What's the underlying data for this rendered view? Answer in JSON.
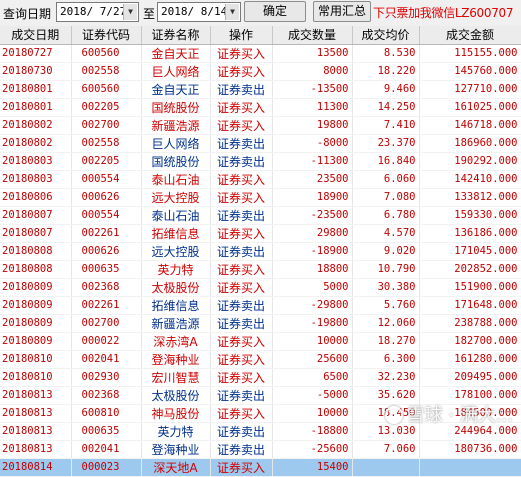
{
  "toolbar": {
    "query_date_label": "查询日期",
    "start_date": "2018/ 7/27",
    "to_label": "至",
    "end_date": "2018/ 8/14",
    "confirm_label": "确定",
    "summary_label": "常用汇总",
    "ad_text": "下只票加我微信LZ600707"
  },
  "table": {
    "headers": [
      "成交日期",
      "证券代码",
      "证券名称",
      "操作",
      "成交数量",
      "成交均价",
      "成交金额"
    ],
    "rows": [
      {
        "date": "20180727",
        "code": "600560",
        "name": "金自天正",
        "op": "证券买入",
        "qty": "13500",
        "price": "8.530",
        "amount": "115155.000",
        "type": "buy"
      },
      {
        "date": "20180730",
        "code": "002558",
        "name": "巨人网络",
        "op": "证券买入",
        "qty": "8000",
        "price": "18.220",
        "amount": "145760.000",
        "type": "buy"
      },
      {
        "date": "20180801",
        "code": "600560",
        "name": "金自天正",
        "op": "证券卖出",
        "qty": "-13500",
        "price": "9.460",
        "amount": "127710.000",
        "type": "sell"
      },
      {
        "date": "20180801",
        "code": "002205",
        "name": "国统股份",
        "op": "证券买入",
        "qty": "11300",
        "price": "14.250",
        "amount": "161025.000",
        "type": "buy"
      },
      {
        "date": "20180802",
        "code": "002700",
        "name": "新疆浩源",
        "op": "证券买入",
        "qty": "19800",
        "price": "7.410",
        "amount": "146718.000",
        "type": "buy"
      },
      {
        "date": "20180802",
        "code": "002558",
        "name": "巨人网络",
        "op": "证券卖出",
        "qty": "-8000",
        "price": "23.370",
        "amount": "186960.000",
        "type": "sell"
      },
      {
        "date": "20180803",
        "code": "002205",
        "name": "国统股份",
        "op": "证券卖出",
        "qty": "-11300",
        "price": "16.840",
        "amount": "190292.000",
        "type": "sell"
      },
      {
        "date": "20180803",
        "code": "000554",
        "name": "泰山石油",
        "op": "证券买入",
        "qty": "23500",
        "price": "6.060",
        "amount": "142410.000",
        "type": "buy"
      },
      {
        "date": "20180806",
        "code": "000626",
        "name": "远大控股",
        "op": "证券买入",
        "qty": "18900",
        "price": "7.080",
        "amount": "133812.000",
        "type": "buy"
      },
      {
        "date": "20180807",
        "code": "000554",
        "name": "泰山石油",
        "op": "证券卖出",
        "qty": "-23500",
        "price": "6.780",
        "amount": "159330.000",
        "type": "sell"
      },
      {
        "date": "20180807",
        "code": "002261",
        "name": "拓维信息",
        "op": "证券买入",
        "qty": "29800",
        "price": "4.570",
        "amount": "136186.000",
        "type": "buy"
      },
      {
        "date": "20180808",
        "code": "000626",
        "name": "远大控股",
        "op": "证券卖出",
        "qty": "-18900",
        "price": "9.020",
        "amount": "171045.000",
        "type": "sell"
      },
      {
        "date": "20180808",
        "code": "000635",
        "name": "英力特",
        "op": "证券买入",
        "qty": "18800",
        "price": "10.790",
        "amount": "202852.000",
        "type": "buy"
      },
      {
        "date": "20180809",
        "code": "002368",
        "name": "太极股份",
        "op": "证券买入",
        "qty": "5000",
        "price": "30.380",
        "amount": "151900.000",
        "type": "buy"
      },
      {
        "date": "20180809",
        "code": "002261",
        "name": "拓维信息",
        "op": "证券卖出",
        "qty": "-29800",
        "price": "5.760",
        "amount": "171648.000",
        "type": "sell"
      },
      {
        "date": "20180809",
        "code": "002700",
        "name": "新疆浩源",
        "op": "证券卖出",
        "qty": "-19800",
        "price": "12.060",
        "amount": "238788.000",
        "type": "sell"
      },
      {
        "date": "20180809",
        "code": "000022",
        "name": "深赤湾A",
        "op": "证券买入",
        "qty": "10000",
        "price": "18.270",
        "amount": "182700.000",
        "type": "buy"
      },
      {
        "date": "20180810",
        "code": "002041",
        "name": "登海种业",
        "op": "证券买入",
        "qty": "25600",
        "price": "6.300",
        "amount": "161280.000",
        "type": "buy"
      },
      {
        "date": "20180810",
        "code": "002930",
        "name": "宏川智慧",
        "op": "证券买入",
        "qty": "6500",
        "price": "32.230",
        "amount": "209495.000",
        "type": "buy"
      },
      {
        "date": "20180813",
        "code": "002368",
        "name": "太极股份",
        "op": "证券卖出",
        "qty": "-5000",
        "price": "35.620",
        "amount": "178100.000",
        "type": "sell"
      },
      {
        "date": "20180813",
        "code": "600810",
        "name": "神马股份",
        "op": "证券买入",
        "qty": "10000",
        "price": "18.450",
        "amount": "184500.000",
        "type": "buy"
      },
      {
        "date": "20180813",
        "code": "000635",
        "name": "英力特",
        "op": "证券卖出",
        "qty": "-18800",
        "price": "13.030",
        "amount": "244964.000",
        "type": "sell"
      },
      {
        "date": "20180813",
        "code": "002041",
        "name": "登海种业",
        "op": "证券卖出",
        "qty": "-25600",
        "price": "7.060",
        "amount": "180736.000",
        "type": "sell"
      },
      {
        "date": "20180814",
        "code": "000023",
        "name": "深天地A",
        "op": "证券买入",
        "qty": "15400",
        "price": "",
        "amount": "",
        "type": "buy"
      }
    ]
  },
  "watermark": {
    "text": "雪球 · 满大...",
    "icon": "snowball-logo-icon"
  }
}
